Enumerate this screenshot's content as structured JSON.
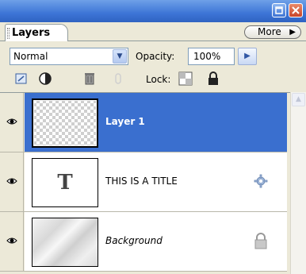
{
  "window": {
    "restore_icon": "restore-icon",
    "close_icon": "close-icon"
  },
  "panel": {
    "tab_label": "Layers",
    "more_label": "More"
  },
  "controls": {
    "blend_mode": "Normal",
    "opacity_label": "Opacity:",
    "opacity_value": "100%",
    "lock_label": "Lock:"
  },
  "layers": [
    {
      "name": "Layer 1",
      "selected": true,
      "thumbnail": "transparent-checker"
    },
    {
      "name": "THIS IS A TITLE",
      "selected": false,
      "thumbnail": "T",
      "status_icon": "gear-icon"
    },
    {
      "name": "Background",
      "selected": false,
      "thumbnail": "marble",
      "status_icon": "lock-icon"
    }
  ],
  "colors": {
    "selection": "#3a6fcf",
    "titlebar": "#3d75d6",
    "panel_bg": "#ece9d8"
  }
}
